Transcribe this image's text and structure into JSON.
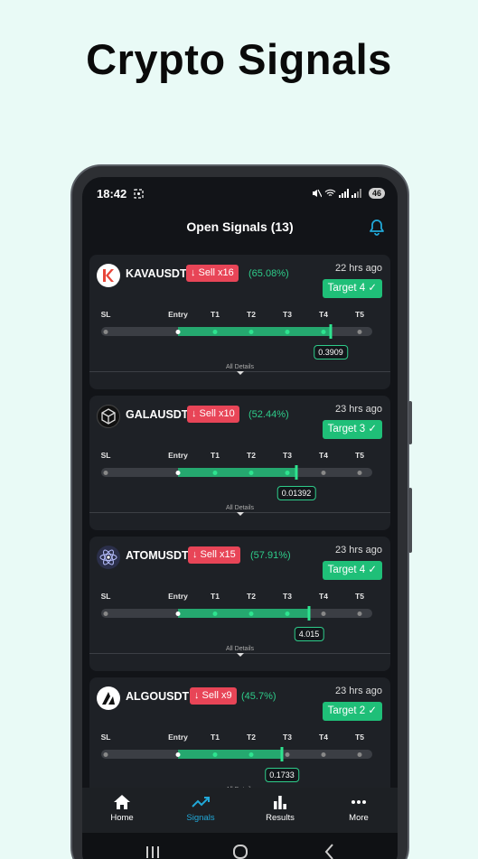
{
  "headline": "Crypto Signals",
  "status": {
    "time": "18:42",
    "battery": "46"
  },
  "header": {
    "title": "Open Signals (13)"
  },
  "colors": {
    "sell": "#e84557",
    "accent_green": "#1fbf78",
    "active_tab": "#21a8d8"
  },
  "ladder_labels": [
    "SL",
    "Entry",
    "T1",
    "T2",
    "T3",
    "T4",
    "T5"
  ],
  "details_label": "All Details",
  "signals": [
    {
      "symbol": "KAVAUSDT",
      "sell": "↓ Sell x16",
      "percent": "(65.08%)",
      "ago": "22 hrs ago",
      "target": "Target 4 ✓",
      "price": "0.3909",
      "progress_level": 4.2
    },
    {
      "symbol": "GALAUSDT",
      "sell": "↓ Sell x10",
      "percent": "(52.44%)",
      "ago": "23 hrs ago",
      "target": "Target 3 ✓",
      "price": "0.01392",
      "progress_level": 3.25
    },
    {
      "symbol": "ATOMUSDT",
      "sell": "↓ Sell x15",
      "percent": "(57.91%)",
      "ago": "23 hrs ago",
      "target": "Target 4 ✓",
      "price": "4.015",
      "progress_level": 3.6
    },
    {
      "symbol": "ALGOUSDT",
      "sell": "↓ Sell x9",
      "percent": "(45.7%)",
      "ago": "23 hrs ago",
      "target": "Target 2 ✓",
      "price": "0.1733",
      "progress_level": 2.85
    }
  ],
  "nav": {
    "home": "Home",
    "signals": "Signals",
    "results": "Results",
    "more": "More"
  }
}
